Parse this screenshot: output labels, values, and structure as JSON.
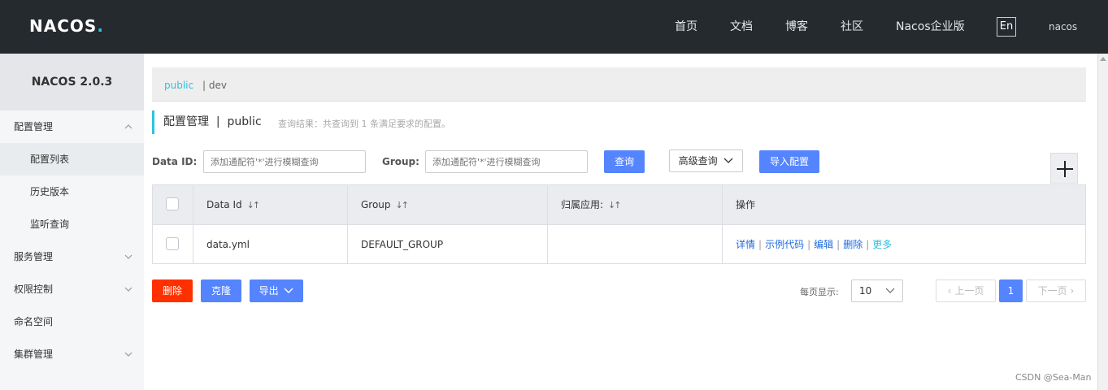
{
  "header": {
    "logo_main": "NACOS",
    "logo_dot": ".",
    "nav": [
      "首页",
      "文档",
      "博客",
      "社区",
      "Nacos企业版"
    ],
    "lang": "En",
    "user": "nacos"
  },
  "sidebar": {
    "title": "NACOS 2.0.3",
    "items": [
      {
        "label": "配置管理",
        "expanded": true
      },
      {
        "label": "配置列表",
        "sub": true,
        "active": true
      },
      {
        "label": "历史版本",
        "sub": true
      },
      {
        "label": "监听查询",
        "sub": true
      },
      {
        "label": "服务管理"
      },
      {
        "label": "权限控制"
      },
      {
        "label": "命名空间"
      },
      {
        "label": "集群管理"
      }
    ]
  },
  "namespace_bar": {
    "current": "public",
    "other": "| dev"
  },
  "page": {
    "title": "配置管理  |  public",
    "result": "查询结果：共查询到 1 条满足要求的配置。"
  },
  "filters": {
    "data_id_label": "Data ID:",
    "data_id_placeholder": "添加通配符'*'进行模糊查询",
    "group_label": "Group:",
    "group_placeholder": "添加通配符'*'进行模糊查询",
    "query_btn": "查询",
    "advanced_btn": "高级查询",
    "import_btn": "导入配置"
  },
  "table": {
    "headers": [
      "Data Id",
      "Group",
      "归属应用:",
      "操作"
    ],
    "rows": [
      {
        "data_id": "data.yml",
        "group": "DEFAULT_GROUP",
        "app": ""
      }
    ],
    "actions": [
      "详情",
      "示例代码",
      "编辑",
      "删除",
      "更多"
    ]
  },
  "bulk": {
    "delete": "删除",
    "clone": "克隆",
    "export": "导出"
  },
  "pagination": {
    "size_label": "每页显示:",
    "size": "10",
    "prev": "上一页",
    "current": "1",
    "next": "下一页"
  },
  "watermark": "CSDN @Sea-Man",
  "colors": {
    "accent": "#2fc1e1",
    "primary": "#5584ff",
    "danger": "#ff3000",
    "topbar": "#252a2f"
  }
}
